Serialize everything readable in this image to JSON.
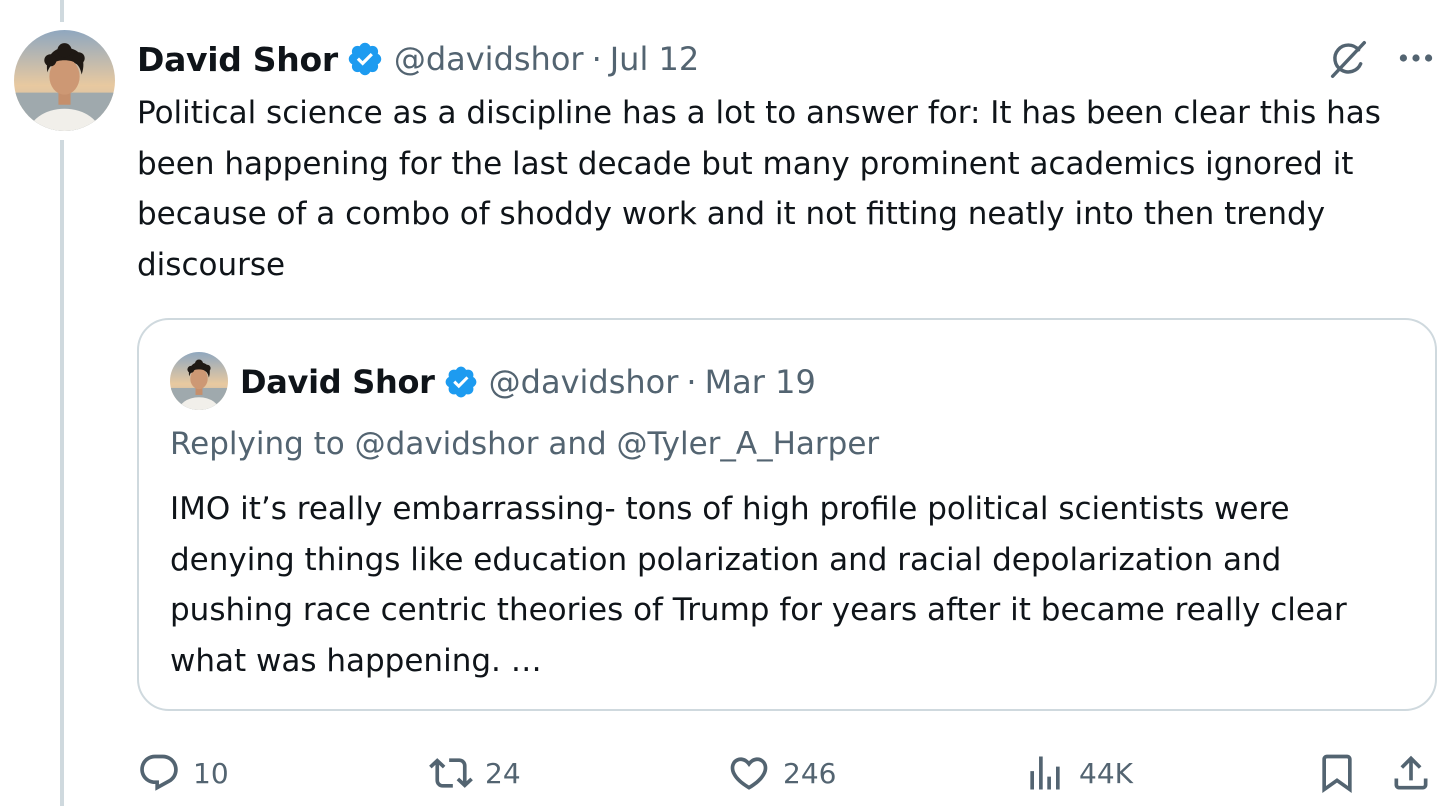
{
  "tweet": {
    "author_name": "David Shor",
    "handle": "@davidshor",
    "separator": "·",
    "date": "Jul 12",
    "text": "Political science as a discipline has a lot to answer for: It has been clear this has been happening for the last decade but many prominent academics ignored it because of a combo of shoddy work and it not fitting neatly into then trendy discourse"
  },
  "quote": {
    "author_name": "David Shor",
    "handle": "@davidshor",
    "separator": "·",
    "date": "Mar 19",
    "replying_prefix": "Replying to",
    "replying_user_1": "@davidshor",
    "replying_and": "and",
    "replying_user_2": "@Tyler_A_Harper",
    "text": "IMO it’s really embarrassing- tons of high profile political scientists were denying things like education polarization and racial depolarization and pushing race centric theories of Trump for years after it became really clear what was happening. …"
  },
  "actions": {
    "replies": "10",
    "retweets": "24",
    "likes": "246",
    "views": "44K"
  },
  "icons": {
    "verified": "verified-badge-icon",
    "grok": "grok-icon",
    "more": "more-icon",
    "reply": "reply-icon",
    "retweet": "retweet-icon",
    "like": "heart-icon",
    "views": "views-icon",
    "bookmark": "bookmark-icon",
    "share": "share-icon"
  },
  "colors": {
    "verified_blue": "#1d9bf0",
    "secondary_text": "#536471",
    "border": "#cfd9de",
    "primary_text": "#0f1419"
  }
}
